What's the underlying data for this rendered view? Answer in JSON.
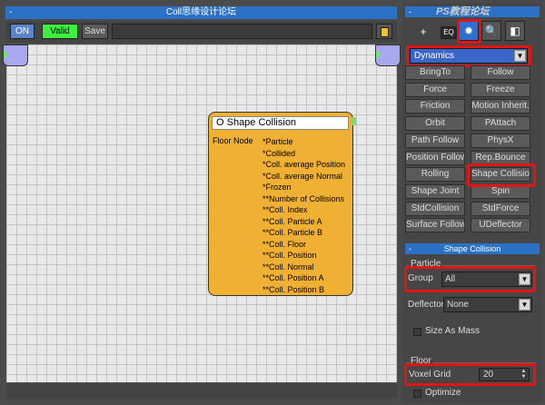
{
  "editor": {
    "title": "Coll思缘设计论坛",
    "title_dash": "-",
    "toolbar": {
      "on_label": "ON",
      "valid_label": "Valid",
      "save_label": "Save"
    }
  },
  "node": {
    "title": "O Shape Collision",
    "input_label": "Floor Node",
    "outputs": [
      "*Particle",
      "*Collided",
      "*Coll. average Position",
      "*Coll. average Normal",
      "*Frozen",
      "**Number of Collisions",
      "**Coll. Index",
      "**Coll. Particle A",
      "**Coll. Particle B",
      "**Coll. Floor",
      "**Coll. Position",
      "**Coll. Normal",
      "**Coll. Position A",
      "**Coll. Position B"
    ]
  },
  "panel": {
    "top_dash": "-",
    "watermark": "PS教程论坛",
    "icons": [
      "add-node-icon",
      "eq-icon",
      "gear-icon",
      "search-icon",
      "cube-icon"
    ],
    "icon_glyphs": {
      "plus": "+",
      "eq": "EQ",
      "gear": "✹",
      "search": "🔍",
      "cube": "◧"
    },
    "category": "Dynamics",
    "dropdown_arrow": "▼",
    "operators": [
      "BringTo",
      "Follow",
      "Force",
      "Freeze",
      "Friction",
      "Motion Inherit.",
      "Orbit",
      "PAttach",
      "Path Follow",
      "PhysX",
      "Position Follow",
      "Rep.Bounce",
      "Rolling",
      "Shape Collision",
      "Shape Joint",
      "Spin",
      "StdCollision",
      "StdForce",
      "Surface Follow",
      "UDeflector"
    ],
    "params": {
      "head_dash": "-",
      "head_title": "Shape Collision",
      "particle_group_label": "Particle",
      "group_label": "Group",
      "group_value": "All",
      "deflector_label": "Deflector",
      "deflector_value": "None",
      "size_as_mass_label": "Size As Mass",
      "floor_group_label": "Floor",
      "voxel_grid_label": "Voxel Grid",
      "voxel_grid_value": "20",
      "optimize_label": "Optimize"
    }
  },
  "colors": {
    "title_bar": "#2b72c6",
    "node_fill": "#f0b033",
    "valid_green": "#3df03d",
    "highlight_red": "#e31414"
  }
}
